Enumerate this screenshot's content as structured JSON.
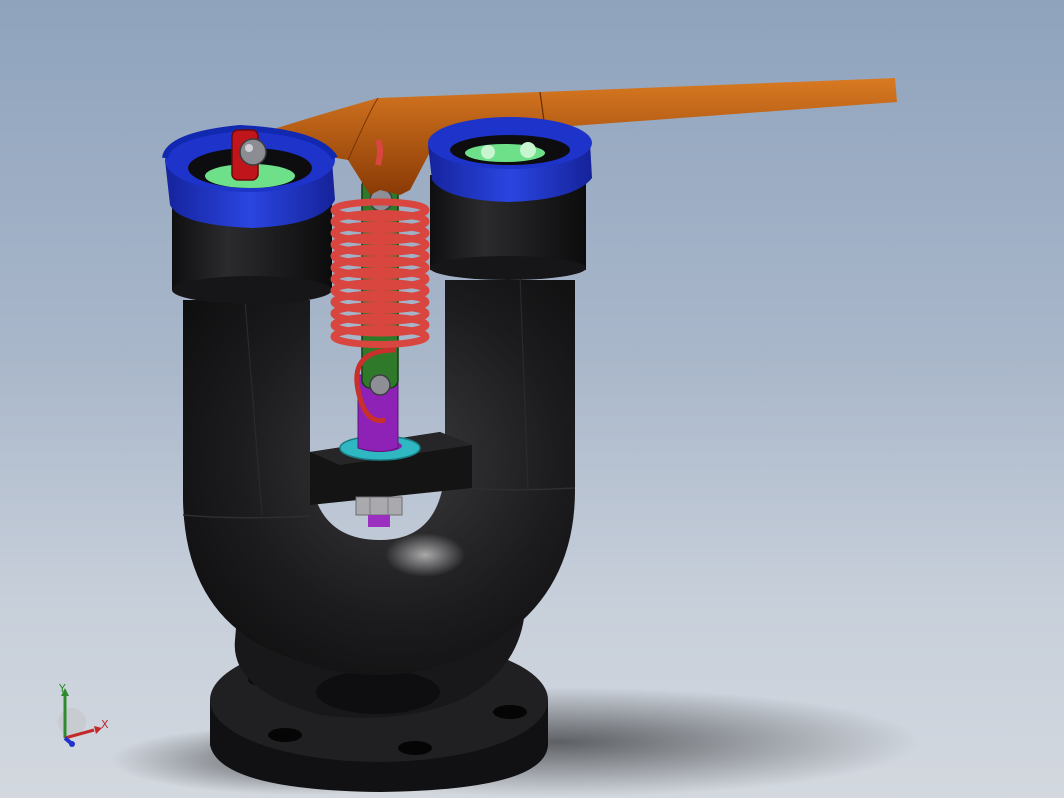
{
  "viewport": {
    "background_top": "#8fa3bd",
    "background_bottom": "#d3d8df"
  },
  "model": {
    "parts": [
      {
        "name": "valve-body",
        "color": "#1c1c1e"
      },
      {
        "name": "base-flange",
        "color": "#1c1c1e"
      },
      {
        "name": "left-port-cap",
        "color": "#1d33c9"
      },
      {
        "name": "right-port-cap",
        "color": "#1d33c9"
      },
      {
        "name": "lever",
        "color": "#b5560c"
      },
      {
        "name": "tension-spring",
        "color": "#d8463f"
      },
      {
        "name": "spring-link",
        "color": "#2a7a2a"
      },
      {
        "name": "clevis",
        "color": "#8b1fb0"
      },
      {
        "name": "washer",
        "color": "#2fb8c2"
      },
      {
        "name": "crossbar",
        "color": "#151515"
      },
      {
        "name": "hex-nut",
        "color": "#b9b9bd"
      },
      {
        "name": "hinge-pin",
        "color": "#c0161b"
      },
      {
        "name": "valve-seat",
        "color": "#6fe08a"
      }
    ]
  },
  "triad": {
    "x_label": "X",
    "y_label": "Y",
    "x_color": "#c22a2a",
    "y_color": "#2f8a2f",
    "z_color": "#2233cc"
  }
}
